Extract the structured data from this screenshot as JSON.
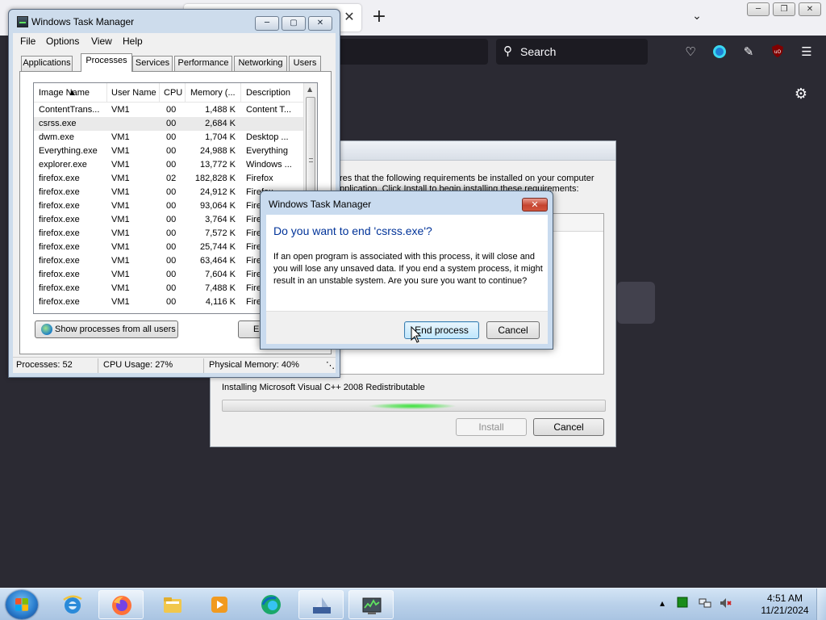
{
  "firefox": {
    "tab_close": "✕",
    "new_tab": "+",
    "search_placeholder": "Search"
  },
  "installer": {
    "text_line1": "res that the following requirements be installed on your computer",
    "text_line2": "pplication. Click Install to begin installing these requirements:",
    "status": "Installing Microsoft Visual C++ 2008 Redistributable",
    "progress_position": 0.5,
    "install_label": "Install",
    "cancel_label": "Cancel"
  },
  "task_manager": {
    "title": "Windows Task Manager",
    "menu": [
      "File",
      "Options",
      "View",
      "Help"
    ],
    "tabs": [
      "Applications",
      "Processes",
      "Services",
      "Performance",
      "Networking",
      "Users"
    ],
    "active_tab": "Processes",
    "columns": [
      "Image Name",
      "User Name",
      "CPU",
      "Memory (...",
      "Description"
    ],
    "rows": [
      {
        "name": "ContentTrans...",
        "user": "VM1",
        "cpu": "00",
        "mem": "1,488 K",
        "desc": "Content T..."
      },
      {
        "name": "csrss.exe",
        "user": "",
        "cpu": "00",
        "mem": "2,684 K",
        "desc": ""
      },
      {
        "name": "dwm.exe",
        "user": "VM1",
        "cpu": "00",
        "mem": "1,704 K",
        "desc": "Desktop ..."
      },
      {
        "name": "Everything.exe",
        "user": "VM1",
        "cpu": "00",
        "mem": "24,988 K",
        "desc": "Everything"
      },
      {
        "name": "explorer.exe",
        "user": "VM1",
        "cpu": "00",
        "mem": "13,772 K",
        "desc": "Windows ..."
      },
      {
        "name": "firefox.exe",
        "user": "VM1",
        "cpu": "02",
        "mem": "182,828 K",
        "desc": "Firefox"
      },
      {
        "name": "firefox.exe",
        "user": "VM1",
        "cpu": "00",
        "mem": "24,912 K",
        "desc": "Firefox"
      },
      {
        "name": "firefox.exe",
        "user": "VM1",
        "cpu": "00",
        "mem": "93,064 K",
        "desc": "Firefox"
      },
      {
        "name": "firefox.exe",
        "user": "VM1",
        "cpu": "00",
        "mem": "3,764 K",
        "desc": "Firefox"
      },
      {
        "name": "firefox.exe",
        "user": "VM1",
        "cpu": "00",
        "mem": "7,572 K",
        "desc": "Firefox"
      },
      {
        "name": "firefox.exe",
        "user": "VM1",
        "cpu": "00",
        "mem": "25,744 K",
        "desc": "Firefox"
      },
      {
        "name": "firefox.exe",
        "user": "VM1",
        "cpu": "00",
        "mem": "63,464 K",
        "desc": "Firefox"
      },
      {
        "name": "firefox.exe",
        "user": "VM1",
        "cpu": "00",
        "mem": "7,604 K",
        "desc": "Firefox"
      },
      {
        "name": "firefox.exe",
        "user": "VM1",
        "cpu": "00",
        "mem": "7,488 K",
        "desc": "Firefox"
      },
      {
        "name": "firefox.exe",
        "user": "VM1",
        "cpu": "00",
        "mem": "4,116 K",
        "desc": "Firefox"
      }
    ],
    "selected_row": 1,
    "show_all_label": "Show processes from all users",
    "end_process_label": "End Process",
    "status": {
      "processes": "Processes: 52",
      "cpu": "CPU Usage: 27%",
      "memory": "Physical Memory: 40%"
    }
  },
  "dialog": {
    "title": "Windows Task Manager",
    "heading": "Do you want to end 'csrss.exe'?",
    "message": "If an open program is associated with this process, it will close and you will lose any unsaved data. If you end a system process, it might result in an unstable system. Are you sure you want to continue?",
    "end_label": "End process",
    "cancel_label": "Cancel"
  },
  "taskbar": {
    "items": [
      "start-orb",
      "internet-explorer",
      "firefox",
      "file-explorer",
      "media-player",
      "edge",
      "installer",
      "task-manager"
    ],
    "active": "firefox",
    "clock_time": "4:51 AM",
    "clock_date": "11/21/2024"
  },
  "colors": {
    "dialog_heading": "#003399",
    "firefox_dark": "#2b2a33",
    "progress_glow": "#3ce23c"
  }
}
